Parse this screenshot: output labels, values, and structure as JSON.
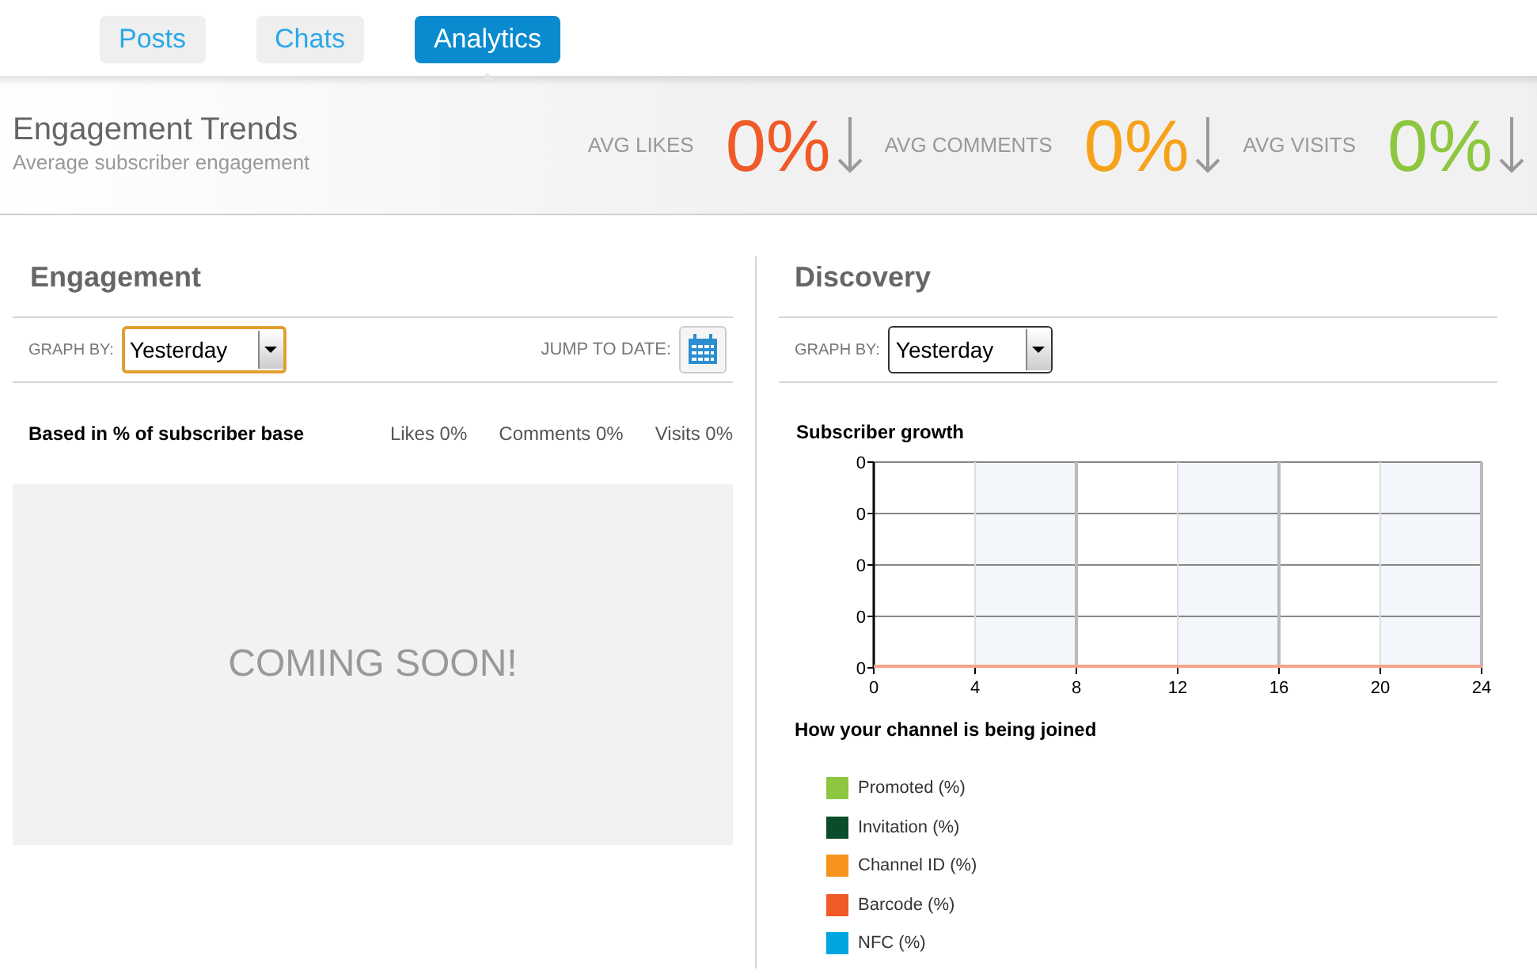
{
  "tabs": [
    {
      "label": "Posts",
      "selected": false
    },
    {
      "label": "Chats",
      "selected": false
    },
    {
      "label": "Analytics",
      "selected": true
    }
  ],
  "header": {
    "title": "Engagement Trends",
    "subtitle": "Average subscriber engagement",
    "stats": [
      {
        "label": "AVG LIKES",
        "value": "0%",
        "color": "#f05a28"
      },
      {
        "label": "AVG COMMENTS",
        "value": "0%",
        "color": "#f7a21b"
      },
      {
        "label": "AVG VISITS",
        "value": "0%",
        "color": "#8dc63f"
      }
    ]
  },
  "engagement": {
    "title": "Engagement",
    "graph_by_label": "GRAPH BY:",
    "graph_by": "Yesterday",
    "jump_label": "JUMP TO DATE:",
    "basis": "Based in % of subscriber base",
    "totals": [
      "Likes 0%",
      "Comments 0%",
      "Visits 0%"
    ],
    "placeholder_text": "COMING SOON!"
  },
  "discovery": {
    "title": "Discovery",
    "graph_by_label": "GRAPH BY:",
    "graph_by": "Yesterday",
    "growth": {
      "title": "Subscriber growth",
      "y_labels": [
        "0",
        "0",
        "0",
        "0",
        "0"
      ],
      "x_labels": [
        "0",
        "4",
        "8",
        "12",
        "16",
        "20",
        "24"
      ]
    },
    "join_title": "How your channel is being joined",
    "legend": [
      {
        "label": "Promoted (%)",
        "color": "#8dc63f"
      },
      {
        "label": "Invitation (%)",
        "color": "#0b4d2a"
      },
      {
        "label": "Channel ID (%)",
        "color": "#f7941d"
      },
      {
        "label": "Barcode (%)",
        "color": "#f05a28"
      },
      {
        "label": "NFC (%)",
        "color": "#00a6e0"
      }
    ]
  }
}
